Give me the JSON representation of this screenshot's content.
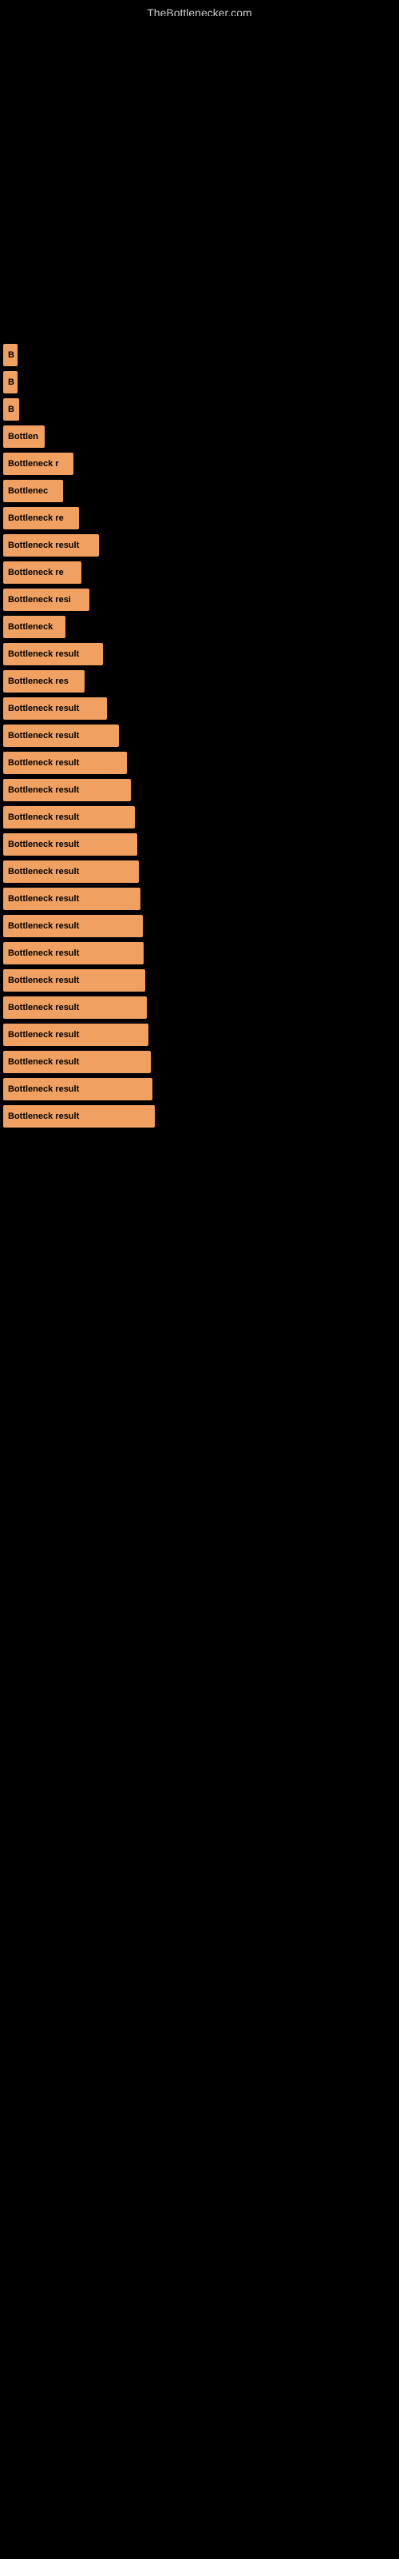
{
  "site": {
    "title": "TheBottlenecker.com"
  },
  "results": [
    {
      "label": "B",
      "width": 18
    },
    {
      "label": "B",
      "width": 18
    },
    {
      "label": "B",
      "width": 20
    },
    {
      "label": "Bottlen",
      "width": 52
    },
    {
      "label": "Bottleneck r",
      "width": 88
    },
    {
      "label": "Bottlenec",
      "width": 75
    },
    {
      "label": "Bottleneck re",
      "width": 95
    },
    {
      "label": "Bottleneck result",
      "width": 120
    },
    {
      "label": "Bottleneck re",
      "width": 98
    },
    {
      "label": "Bottleneck resi",
      "width": 108
    },
    {
      "label": "Bottleneck",
      "width": 78
    },
    {
      "label": "Bottleneck result",
      "width": 125
    },
    {
      "label": "Bottleneck res",
      "width": 102
    },
    {
      "label": "Bottleneck result",
      "width": 130
    },
    {
      "label": "Bottleneck result",
      "width": 145
    },
    {
      "label": "Bottleneck result",
      "width": 155
    },
    {
      "label": "Bottleneck result",
      "width": 160
    },
    {
      "label": "Bottleneck result",
      "width": 165
    },
    {
      "label": "Bottleneck result",
      "width": 168
    },
    {
      "label": "Bottleneck result",
      "width": 170
    },
    {
      "label": "Bottleneck result",
      "width": 172
    },
    {
      "label": "Bottleneck result",
      "width": 175
    },
    {
      "label": "Bottleneck result",
      "width": 176
    },
    {
      "label": "Bottleneck result",
      "width": 178
    },
    {
      "label": "Bottleneck result",
      "width": 180
    },
    {
      "label": "Bottleneck result",
      "width": 182
    },
    {
      "label": "Bottleneck result",
      "width": 185
    },
    {
      "label": "Bottleneck result",
      "width": 187
    },
    {
      "label": "Bottleneck result",
      "width": 190
    }
  ]
}
